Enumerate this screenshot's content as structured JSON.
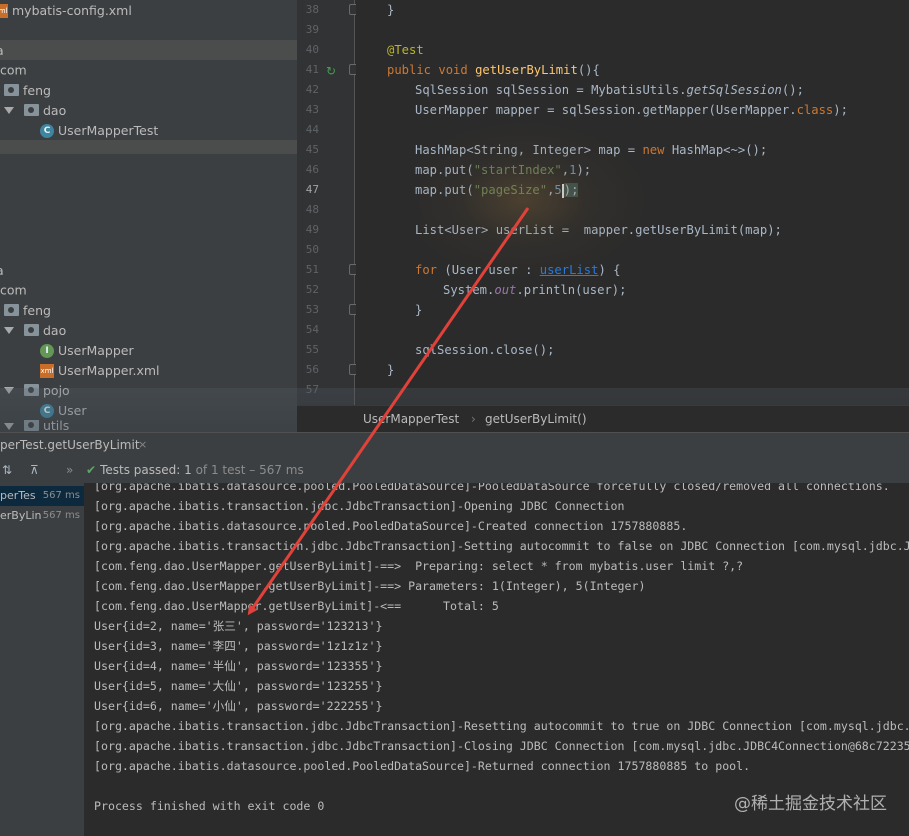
{
  "project_tree": {
    "items": [
      {
        "label": "mybatis-config.xml",
        "icon": "xml-file-icon"
      },
      {
        "label": "a"
      },
      {
        "label": "com"
      },
      {
        "label": "feng"
      },
      {
        "label": "dao"
      },
      {
        "label": "UserMapperTest",
        "icon": "java-class-icon"
      },
      {
        "label": "a"
      },
      {
        "label": "com"
      },
      {
        "label": "feng"
      },
      {
        "label": "dao"
      },
      {
        "label": "UserMapper",
        "icon": "interface-icon"
      },
      {
        "label": "UserMapper.xml",
        "icon": "xml-file-icon"
      },
      {
        "label": "pojo"
      },
      {
        "label": "User",
        "icon": "java-class-icon"
      },
      {
        "label": "utils"
      }
    ]
  },
  "editor": {
    "line_numbers": [
      "38",
      "39",
      "40",
      "41",
      "42",
      "43",
      "44",
      "45",
      "46",
      "47",
      "48",
      "49",
      "50",
      "51",
      "52",
      "53",
      "54",
      "55",
      "56",
      "57"
    ],
    "current_line": "47",
    "code": {
      "l38": "}",
      "l40": "@Test",
      "l41_kw1": "public",
      "l41_kw2": "void",
      "l41_fn": "getUserByLimit",
      "l41_rest": "(){",
      "l42_a": "SqlSession sqlSession = MybatisUtils.",
      "l42_b": "getSqlSession",
      "l42_c": "();",
      "l43_a": "UserMapper mapper = sqlSession.getMapper(UserMapper.",
      "l43_kw": "class",
      "l43_c": ");",
      "l45_a": "HashMap<String, Integer> map = ",
      "l45_kw": "new",
      "l45_c": " HashMap<~>();",
      "l46_a": "map.put(",
      "l46_str": "\"startIndex\"",
      "l46_b": ",",
      "l46_num": "1",
      "l46_c": ");",
      "l47_a": "map.put(",
      "l47_str": "\"pageSize\"",
      "l47_b": ",",
      "l47_num": "5",
      "l47_c": ");",
      "l49": "List<User> userList =  mapper.getUserByLimit(map);",
      "l51_kw": "for",
      "l51_a": " (User user : ",
      "l51_link": "userList",
      "l51_b": ") {",
      "l52_a": "System.",
      "l52_fld": "out",
      "l52_b": ".println(user);",
      "l53": "}",
      "l55": "sqlSession.close();",
      "l56": "}"
    },
    "breadcrumb": [
      "UserMapperTest",
      "getUserByLimit()"
    ]
  },
  "run_panel": {
    "tab_label": "perTest.getUserByLimit",
    "tab_close": "×",
    "status_prefix": "Tests passed:",
    "status_count": "1",
    "status_suffix": "of 1 test – 567 ms",
    "test_tree": [
      {
        "label": "perTes",
        "time": "567 ms"
      },
      {
        "label": "erByLin",
        "time": "567 ms"
      }
    ],
    "console": [
      "[org.apache.ibatis.datasource.pooled.PooledDataSource]-PooledDataSource forcefully closed/removed all connections.",
      "[org.apache.ibatis.transaction.jdbc.JdbcTransaction]-Opening JDBC Connection",
      "[org.apache.ibatis.datasource.pooled.PooledDataSource]-Created connection 1757880885.",
      "[org.apache.ibatis.transaction.jdbc.JdbcTransaction]-Setting autocommit to false on JDBC Connection [com.mysql.jdbc.J",
      "[com.feng.dao.UserMapper.getUserByLimit]-==>  Preparing: select * from mybatis.user limit ?,?",
      "[com.feng.dao.UserMapper.getUserByLimit]-==> Parameters: 1(Integer), 5(Integer)",
      "[com.feng.dao.UserMapper.getUserByLimit]-<==      Total: 5",
      "User{id=2, name='张三', password='123213'}",
      "User{id=3, name='李四', password='1z1z1z'}",
      "User{id=4, name='半仙', password='123355'}",
      "User{id=5, name='大仙', password='123255'}",
      "User{id=6, name='小仙', password='222255'}",
      "[org.apache.ibatis.transaction.jdbc.JdbcTransaction]-Resetting autocommit to true on JDBC Connection [com.mysql.jdbc.",
      "[org.apache.ibatis.transaction.jdbc.JdbcTransaction]-Closing JDBC Connection [com.mysql.jdbc.JDBC4Connection@68c72235",
      "[org.apache.ibatis.datasource.pooled.PooledDataSource]-Returned connection 1757880885 to pool.",
      "",
      "Process finished with exit code 0"
    ]
  },
  "watermark": "@稀土掘金技术社区",
  "colors": {
    "arrow": "#e0423a",
    "pass": "#59a869",
    "keyword": "#cc7832",
    "string": "#6a8759",
    "number": "#6897bb"
  }
}
